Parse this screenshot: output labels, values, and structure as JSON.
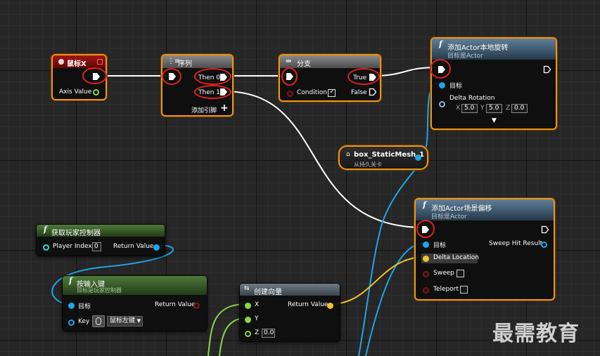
{
  "nodes": {
    "mouse_x": {
      "title": "鼠标X",
      "axis_value": "Axis Value"
    },
    "sequence": {
      "title": "序列",
      "then0": "Then 0",
      "then1": "Then 1",
      "add_pin": "添加引脚"
    },
    "branch": {
      "title": "分支",
      "condition": "Condition",
      "true_label": "True",
      "false_label": "False"
    },
    "add_rotation": {
      "title": "添加Actor本地旋转",
      "subtitle": "目标是Actor",
      "target": "目标",
      "delta_rotation": "Delta Rotation",
      "x_label": "X",
      "x_value": "5.0",
      "y_label": "Y",
      "y_value": "5.0",
      "z_label": "Z",
      "z_value": "0.0"
    },
    "static_mesh": {
      "title": "box_StaticMesh_1",
      "subtitle": "从持久关卡"
    },
    "add_offset": {
      "title": "添加Actor场景偏移",
      "subtitle": "目标是Actor",
      "target": "目标",
      "sweep_hit": "Sweep Hit Result",
      "delta_location": "Delta Location",
      "sweep": "Sweep",
      "teleport": "Teleport"
    },
    "get_controller": {
      "title": "获取玩家控制器",
      "player_index": "Player Index",
      "player_index_value": "0",
      "return_value": "Return Value"
    },
    "key_down": {
      "title": "按输入键",
      "subtitle": "目标是玩家控制器",
      "target": "目标",
      "return_value": "Return Value",
      "key": "Key",
      "key_value": "鼠标左键"
    },
    "make_vector": {
      "title": "创建向量",
      "x": "X",
      "y": "Y",
      "z": "Z",
      "z_value": "0.0",
      "return_value": "Return Value"
    }
  },
  "watermark": "最需教育",
  "colors": {
    "exec": "#ffffff",
    "object": "#1ea5e8",
    "bool": "#8b1515",
    "float": "#8bd54a",
    "vector": "#f2c22c",
    "rotator": "#8db1e6",
    "selection": "#e8961b",
    "highlight_ring": "#e0201e"
  }
}
